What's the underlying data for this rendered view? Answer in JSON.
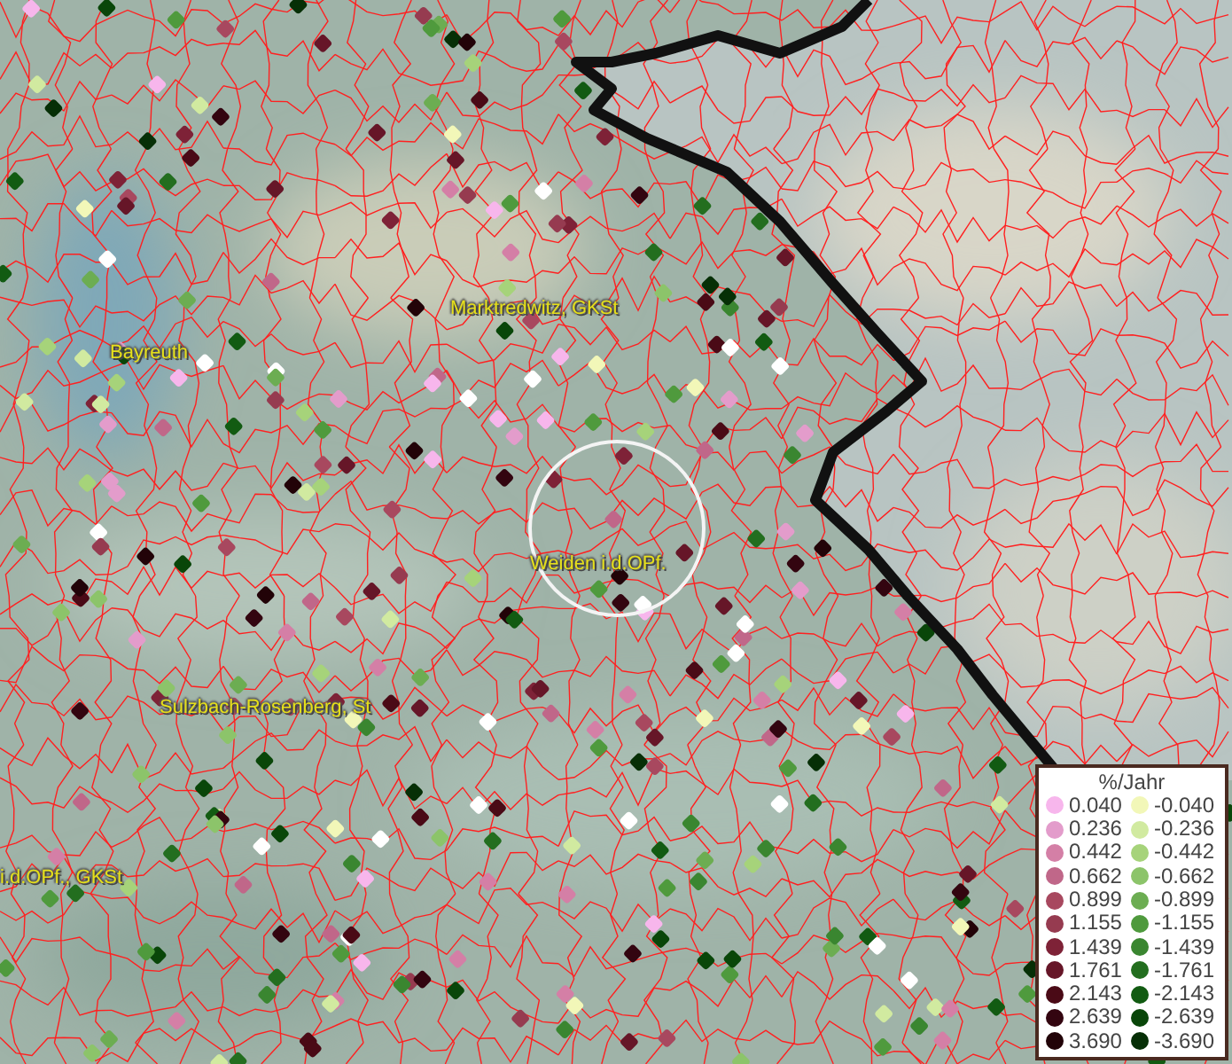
{
  "map": {
    "places": [
      {
        "name": "Marktredwitz, GKSt"
      },
      {
        "name": "Bayreuth"
      },
      {
        "name": "Weiden i.d.OPf."
      },
      {
        "name": "Sulzbach-Rosenberg, St"
      },
      {
        "name": "i.d.OPf., GKSt"
      }
    ]
  },
  "legend": {
    "title": "%/Jahr",
    "positive": [
      {
        "value": "0.040",
        "color": "#f7b6ec"
      },
      {
        "value": "0.236",
        "color": "#e39ccb"
      },
      {
        "value": "0.442",
        "color": "#d47fa6"
      },
      {
        "value": "0.662",
        "color": "#c06789"
      },
      {
        "value": "0.899",
        "color": "#a8485f"
      },
      {
        "value": "1.155",
        "color": "#963b50"
      },
      {
        "value": "1.439",
        "color": "#7e2237"
      },
      {
        "value": "1.761",
        "color": "#661628"
      },
      {
        "value": "2.143",
        "color": "#4a0a16"
      },
      {
        "value": "2.639",
        "color": "#330510"
      },
      {
        "value": "3.690",
        "color": "#220308"
      }
    ],
    "negative": [
      {
        "value": "-0.040",
        "color": "#f2f7b8"
      },
      {
        "value": "-0.236",
        "color": "#d1eaa0"
      },
      {
        "value": "-0.442",
        "color": "#a6d37a"
      },
      {
        "value": "-0.662",
        "color": "#8cc46a"
      },
      {
        "value": "-0.899",
        "color": "#6cad52"
      },
      {
        "value": "-1.155",
        "color": "#4f9a3d"
      },
      {
        "value": "-1.439",
        "color": "#3a8630"
      },
      {
        "value": "-1.761",
        "color": "#236e1f"
      },
      {
        "value": "-2.143",
        "color": "#125b12"
      },
      {
        "value": "-2.639",
        "color": "#094609"
      },
      {
        "value": "-3.690",
        "color": "#062f06"
      }
    ]
  }
}
